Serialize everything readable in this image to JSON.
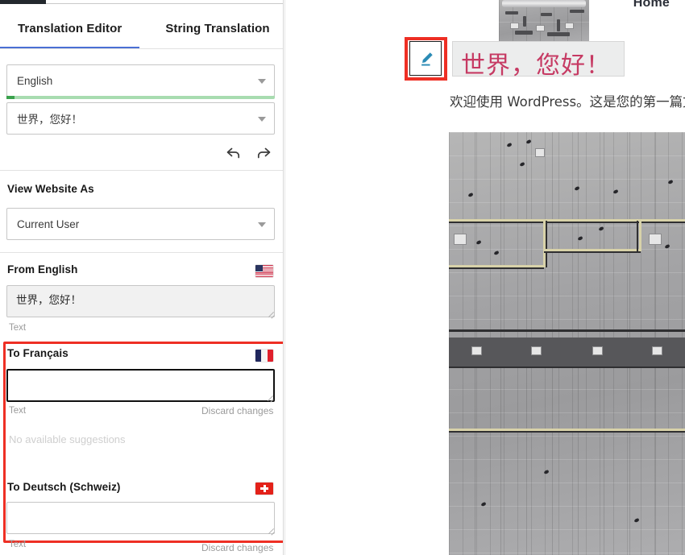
{
  "left_panel": {
    "tabs": [
      {
        "label": "Translation Editor",
        "active": true
      },
      {
        "label": "String Translation",
        "active": false
      }
    ],
    "language_select": {
      "value": "English",
      "caret": "chevron-down-icon"
    },
    "progress": {
      "percent": 3,
      "track_color": "#a8dcb0",
      "fill_color": "#3aa14c"
    },
    "document_select": {
      "value": "世界，您好！",
      "caret": "chevron-down-icon"
    },
    "history": {
      "undo": {
        "icon": "undo-arrow-icon",
        "label": "Undo"
      },
      "redo": {
        "icon": "redo-arrow-icon",
        "label": "Redo"
      }
    },
    "view_website_as": {
      "title": "View Website As",
      "select": {
        "value": "Current User",
        "caret": "chevron-down-icon"
      }
    },
    "source": {
      "title": "From English",
      "flag": "flag-united-states",
      "value": "世界，您好！",
      "meta": "Text"
    },
    "targets": [
      {
        "title": "To Français",
        "flag": "flag-france",
        "value": "",
        "meta": "Text",
        "discard": "Discard changes",
        "suggestions": "No available suggestions",
        "focused": true
      },
      {
        "title": "To Deutsch (Schweiz)",
        "flag": "flag-switzerland",
        "value": "",
        "meta": "Text",
        "discard": "Discard changes",
        "focused": false
      }
    ],
    "highlight_color": "#ee2f24"
  },
  "preview": {
    "nav": {
      "home": "Home"
    },
    "post": {
      "title": "世界，您好！",
      "title_color": "#c63a63",
      "excerpt": "欢迎使用 WordPress。这是您的第一篇文章",
      "edit_button": {
        "icon": "pencil-edit-icon",
        "color": "#2b8bb5"
      }
    },
    "highlight_color": "#ee2f24"
  }
}
